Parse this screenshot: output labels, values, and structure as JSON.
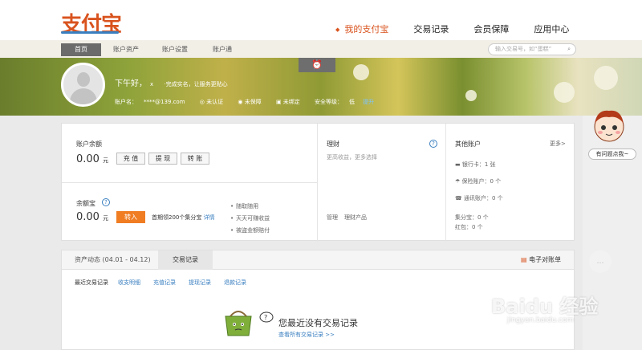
{
  "logo_text": "支付宝",
  "main_nav": [
    "我的支付宝",
    "交易记录",
    "会员保障",
    "应用中心"
  ],
  "sub_nav": [
    "首页",
    "账户资产",
    "账户设置",
    "账户通"
  ],
  "search": {
    "placeholder": "输入交易号，如“蛋糕”"
  },
  "profile": {
    "greeting": "下午好，",
    "signature": "x",
    "slogan": "·完成实名，让服务更贴心",
    "account_label": "账户名：",
    "account_value": "****@139.com",
    "badges": [
      "未认证",
      "未保障",
      "未绑定"
    ],
    "security_label": "安全等级：",
    "security_level": "低",
    "security_link": "提升"
  },
  "clock_icon": "alarm-clock-icon",
  "balance": {
    "title": "账户余额",
    "amount": "0.00",
    "unit": "元",
    "buttons": [
      "充 值",
      "提 现",
      "转 账"
    ]
  },
  "yuebao": {
    "title": "余额宝",
    "amount": "0.00",
    "unit": "元",
    "button": "转入",
    "promo": "首期领200个集分宝",
    "promo_link": "详情",
    "bullets": [
      "随取随用",
      "天天可赚收益",
      "被盗金额赔付"
    ]
  },
  "licai": {
    "title": "理财",
    "subtitle": "更高收益，更多选择",
    "links": [
      "管理",
      "理财产品"
    ]
  },
  "other_accounts": {
    "title": "其他账户",
    "more": "更多>",
    "items": [
      "银行卡：1 张",
      "保险账户：0 个",
      "通讯账户：0 个"
    ],
    "jifen": "集分宝：0 个",
    "hongbao": "红包：0 个"
  },
  "records": {
    "tab_assets": "资产动态 (04.01 - 04.12)",
    "tab_trade": "交易记录",
    "ebill": "电子对账单",
    "filters": [
      "最近交易记录",
      "收支明细",
      "充值记录",
      "提现记录",
      "退款记录"
    ],
    "empty_text": "您最近没有交易记录",
    "empty_link": "查看所有交易记录 >>"
  },
  "helper_label": "有问题点我~",
  "watermark": "Baidu 经验",
  "watermark_sub": "jingyan.baidu.com",
  "colors": {
    "brand": "#d9531e",
    "link": "#3a7fc0",
    "orange": "#f07d22"
  }
}
